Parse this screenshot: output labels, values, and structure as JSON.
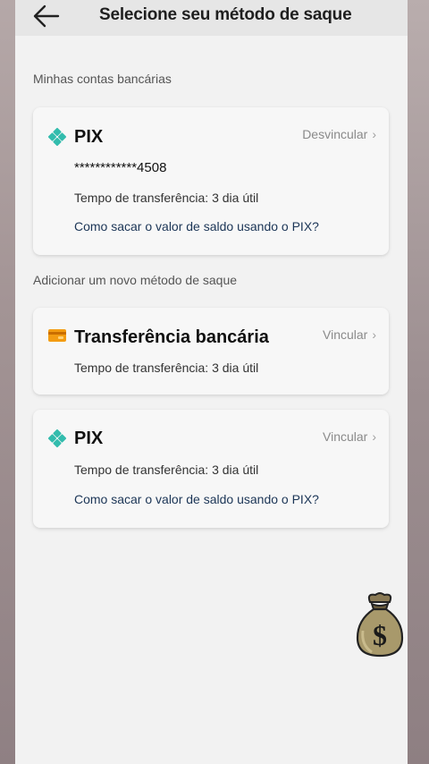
{
  "header": {
    "title": "Selecione seu método de saque",
    "back_icon": "arrow-left-icon"
  },
  "my_accounts": {
    "section_label": "Minhas contas bancárias",
    "card": {
      "icon": "pix-diamond-icon",
      "icon_color": "#32bcad",
      "title": "PIX",
      "action": "Desvincular",
      "masked_account": "************4508",
      "transfer_time": "Tempo de transferência: 3 dia útil",
      "help_link": "Como sacar o valor de saldo usando o PIX?"
    }
  },
  "add_method": {
    "section_label": "Adicionar um novo método de saque",
    "bank_card": {
      "icon": "bank-card-icon",
      "icon_color": "#f39c12",
      "title": "Transferência bancária",
      "action": "Vincular",
      "transfer_time": "Tempo de transferência: 3 dia útil"
    },
    "pix_card": {
      "icon": "pix-diamond-icon",
      "icon_color": "#32bcad",
      "title": "PIX",
      "action": "Vincular",
      "transfer_time": "Tempo de transferência: 3 dia útil",
      "help_link": "Como sacar o valor de saldo usando o PIX?"
    }
  },
  "sticker": {
    "icon": "money-bag-icon"
  }
}
